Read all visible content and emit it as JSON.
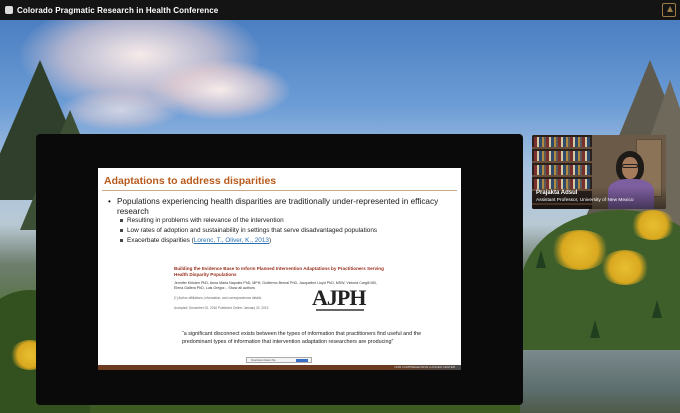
{
  "window": {
    "title": "Colorado Pragmatic Research in Health Conference"
  },
  "slide": {
    "title": "Adaptations to address disparities",
    "bullet_main": "Populations experiencing health disparities are traditionally under-represented in efficacy research",
    "sub_bullets": [
      "Resulting in problems with relevance of the intervention",
      "Low rates of adoption and sustainability in settings that serve disadvantaged populations"
    ],
    "sub_bullet_3_text": "Exacerbate disparities (",
    "sub_bullet_3_link": "Lorenc, T., Oliver, K., 2013",
    "sub_bullet_3_end": ")",
    "paper": {
      "title": "Building the Evidence Base to Inform Planned Intervention Adaptations by Practitioners Serving Health Disparity Populations",
      "authors": "Jennifer Kirkden PhD, Anna Maria Napoles PhD, MPH, Guillermo Bernal PhD, Jacqueline Lloyd PhD, MSW, Victoria Cargill MD, Elena Gallera PhD, Luis Gregor... Show all authors",
      "affiliations": "[+] Author affiliations, information, and correspondence details",
      "dates": "Accepted: December 02, 2016     Published Online: January 30, 2019",
      "journal_logo": "AJPH"
    },
    "quote": "“a significant disconnect exists between the types of information that practitioners find useful and the predominant types of information that intervention adaptation researchers are producing”",
    "search_placeholder": "Download citation file",
    "footer_text": "UNM COMPREHENSIVE CANCER CENTER"
  },
  "speaker": {
    "name": "Prajakta Adsul",
    "role": "Assistant Professor, University of New Mexico"
  },
  "colors": {
    "slide_title": "#b85a1c",
    "paper_title": "#9a2f1c",
    "link": "#2a6fb0",
    "topbar": "#141414"
  },
  "icons": [
    "app-logo-icon",
    "conference-corner-icon"
  ]
}
